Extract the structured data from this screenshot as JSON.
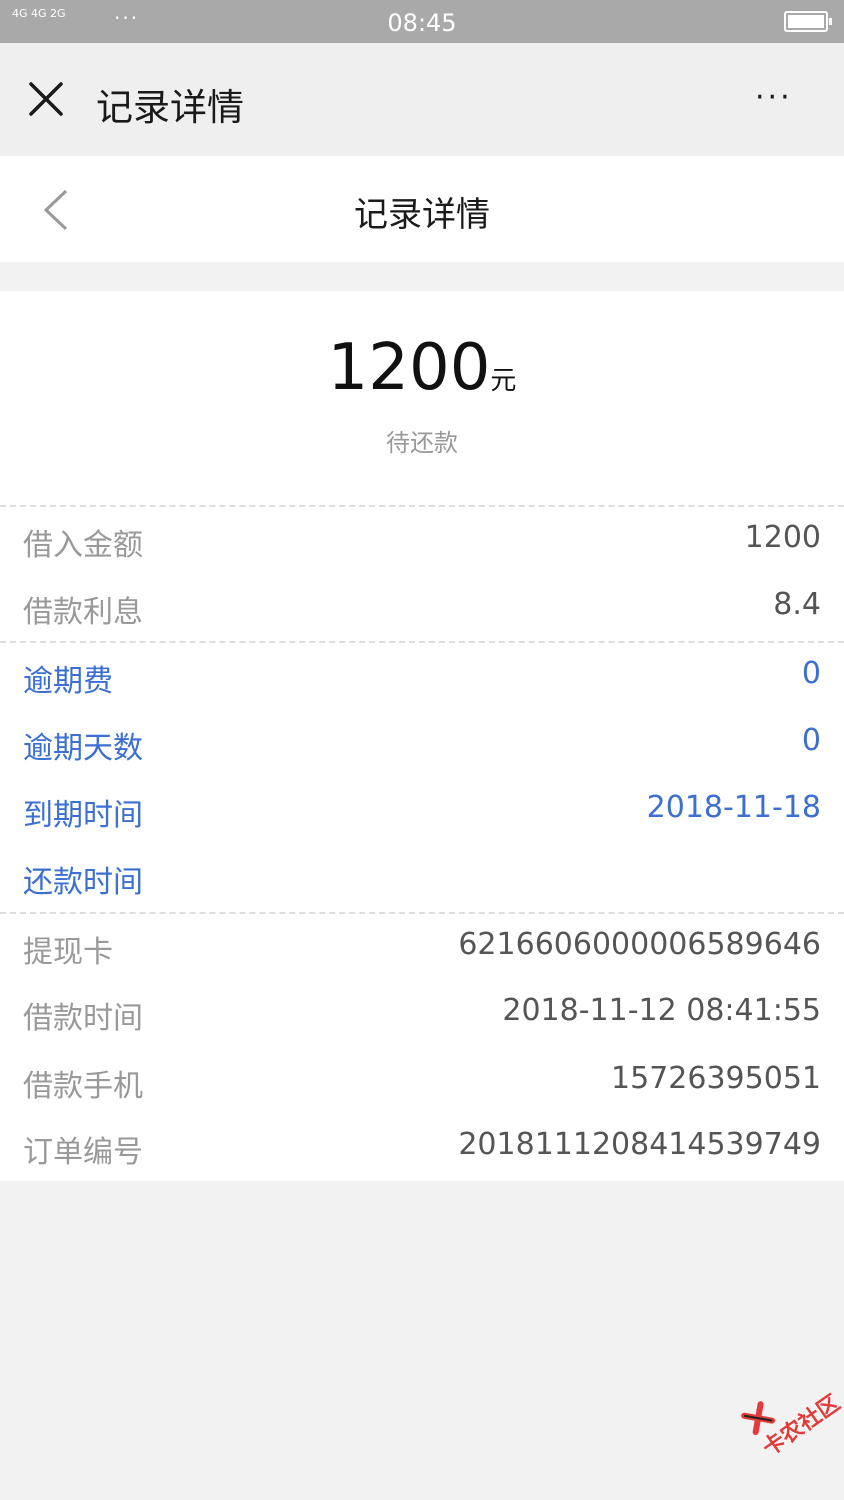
{
  "statusbar": {
    "signal": "4G 4G 2G",
    "dots": "···",
    "time": "08:45"
  },
  "wechat_bar": {
    "title": "记录详情",
    "more": "···"
  },
  "header": {
    "title": "记录详情"
  },
  "summary": {
    "amount": "1200",
    "unit": "元",
    "status": "待还款"
  },
  "group1": [
    {
      "label": "借入金额",
      "value": "1200"
    },
    {
      "label": "借款利息",
      "value": "8.4"
    }
  ],
  "group2": [
    {
      "label": "逾期费",
      "value": "0"
    },
    {
      "label": "逾期天数",
      "value": "0"
    },
    {
      "label": "到期时间",
      "value": "2018-11-18"
    },
    {
      "label": "还款时间",
      "value": ""
    }
  ],
  "group3": [
    {
      "label": "提现卡",
      "value": "6216606000006589646"
    },
    {
      "label": "借款时间",
      "value": "2018-11-12 08:41:55"
    },
    {
      "label": "借款手机",
      "value": "15726395051"
    },
    {
      "label": "订单编号",
      "value": "2018111208414539749"
    }
  ],
  "watermark": {
    "text": "卡农社区"
  },
  "colors": {
    "accent_blue": "#3b6fd0",
    "watermark_red": "#e43a3a"
  }
}
